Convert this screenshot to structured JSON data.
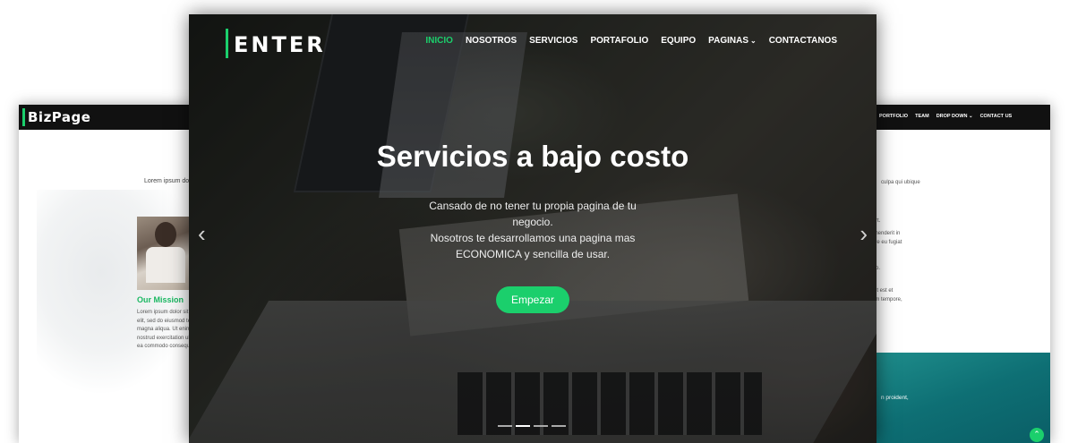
{
  "left_page": {
    "logo": "BizPage",
    "tagline": "Lorem ipsum do",
    "mission_title": "Our Mission",
    "mission_lines": [
      "Lorem ipsum dolor sit",
      "elit, sed do eiusmod te",
      "magna aliqua. Ut enim",
      "nostrud exercitation ul",
      "ea commodo consequ"
    ]
  },
  "right_page": {
    "nav": [
      "PORTFOLIO",
      "TEAM",
      "DROP DOWN",
      "CONTACT US"
    ],
    "fragments": [
      "culpa qui ubique",
      "rt.",
      "ehenderit in",
      "ore eu fugiat",
      "ro.",
      "nt est et",
      "im tempore,"
    ],
    "teal_text": "n proident,"
  },
  "main": {
    "brand": "ENTER",
    "nav": [
      {
        "label": "INICIO",
        "active": true
      },
      {
        "label": "NOSOTROS",
        "active": false
      },
      {
        "label": "SERVICIOS",
        "active": false
      },
      {
        "label": "PORTAFOLIO",
        "active": false
      },
      {
        "label": "EQUIPO",
        "active": false
      },
      {
        "label": "PAGINAS",
        "active": false
      },
      {
        "label": "CONTACTANOS",
        "active": false
      }
    ],
    "hero_title": "Servicios a bajo costo",
    "hero_lines": [
      "Cansado de no tener tu propia pagina de tu",
      "negocio.",
      "Nosotros te desarrollamos una pagina mas",
      "ECONOMICA y sencilla de usar."
    ],
    "cta_label": "Empezar",
    "prev_arrow": "‹",
    "next_arrow": "›",
    "active_slide": 2,
    "slide_count": 4
  },
  "colors": {
    "accent": "#1bcf6c",
    "teal": "#0e6f74",
    "header_dark": "#111111"
  },
  "icons": {
    "dropdown": "chevron-down-icon",
    "scroll_top": "chevron-up-icon"
  }
}
